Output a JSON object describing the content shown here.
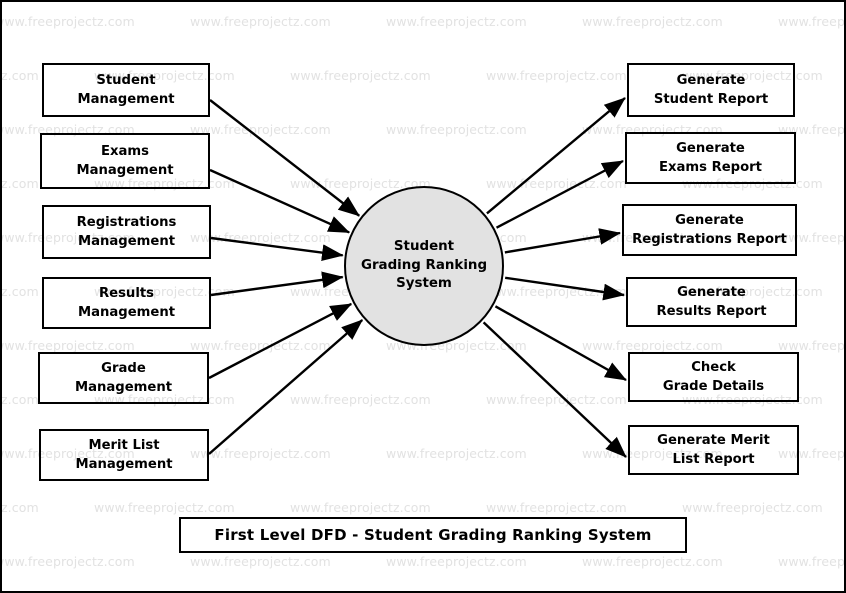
{
  "diagram": {
    "title": "First Level DFD - Student Grading Ranking System",
    "process": {
      "name": "Student Grading Ranking System",
      "line1": "Student",
      "line2": "Grading Ranking",
      "line3": "System",
      "fill": "#e2e2e2",
      "stroke": "#000000"
    },
    "inputs": [
      {
        "line1": "Student",
        "line2": "Management"
      },
      {
        "line1": "Exams",
        "line2": "Management"
      },
      {
        "line1": "Registrations",
        "line2": "Management"
      },
      {
        "line1": "Results",
        "line2": "Management"
      },
      {
        "line1": "Grade",
        "line2": "Management"
      },
      {
        "line1": "Merit List",
        "line2": "Management"
      }
    ],
    "outputs": [
      {
        "line1": "Generate",
        "line2": "Student Report"
      },
      {
        "line1": "Generate",
        "line2": "Exams Report"
      },
      {
        "line1": "Generate",
        "line2": "Registrations Report"
      },
      {
        "line1": "Generate",
        "line2": "Results Report"
      },
      {
        "line1": "Check",
        "line2": "Grade Details"
      },
      {
        "line1": "Generate Merit",
        "line2": "List Report"
      }
    ],
    "watermark": {
      "text": "www.freeprojectz.com",
      "color": "#e2e2e2"
    }
  }
}
